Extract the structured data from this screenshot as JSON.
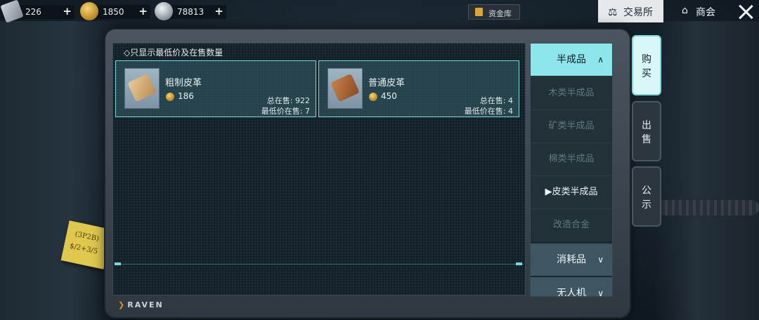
{
  "currencies": [
    {
      "icon": "ticket-icon",
      "value": "226",
      "plus": "+"
    },
    {
      "icon": "gold-coin-icon",
      "value": "1850",
      "plus": "+"
    },
    {
      "icon": "silver-coin-icon",
      "value": "78813",
      "plus": "+"
    }
  ],
  "fund_button": {
    "label": "资金库",
    "icon": "vault-icon"
  },
  "nav_tabs": {
    "trade": {
      "label": "交易所",
      "icon": "scale-icon"
    },
    "guild": {
      "label": "商会",
      "icon": "house-icon"
    }
  },
  "filter": {
    "label": "◇只显示最低价及在售数量"
  },
  "items": [
    {
      "name": "粗制皮革",
      "price": "186",
      "total_label": "总在售:",
      "total": "922",
      "min_label": "最低价在售:",
      "min": "7",
      "icon": "rough-leather-icon"
    },
    {
      "name": "普通皮革",
      "price": "450",
      "total_label": "总在售:",
      "total": "4",
      "min_label": "最低价在售:",
      "min": "4",
      "icon": "common-leather-icon"
    }
  ],
  "categories": [
    {
      "label": "半成品",
      "kind": "head",
      "arrow": "∧"
    },
    {
      "label": "木类半成品",
      "kind": "sub"
    },
    {
      "label": "矿类半成品",
      "kind": "sub"
    },
    {
      "label": "棉类半成品",
      "kind": "sub"
    },
    {
      "label": "▶皮类半成品",
      "kind": "sub-selected"
    },
    {
      "label": "改造合金",
      "kind": "sub"
    },
    {
      "label": "消耗品",
      "kind": "group",
      "arrow": "∨"
    },
    {
      "label": "无人机",
      "kind": "group",
      "arrow": "∨"
    }
  ],
  "side_tabs": [
    {
      "line1": "购",
      "line2": "买",
      "active": true
    },
    {
      "line1": "出",
      "line2": "售",
      "active": false
    },
    {
      "line1": "公",
      "line2": "示",
      "active": false
    }
  ],
  "sticky_note": {
    "line1": "(3P2B)",
    "line2": "$/2+3/5"
  },
  "brand": {
    "logo_text": "RAVEN"
  },
  "colors": {
    "accent": "#7fd6dc",
    "category_head": "#8de6ec",
    "trade_tab_bg": "#e6e9eb",
    "gold": "#d9a63a"
  }
}
